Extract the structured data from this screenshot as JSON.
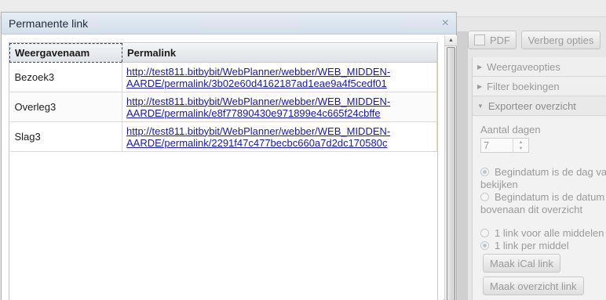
{
  "dialog": {
    "title": "Permanente link",
    "close_glyph": "×",
    "table": {
      "headers": [
        "Weergavenaam",
        "Permalink"
      ],
      "rows": [
        {
          "name": "Bezoek3",
          "link_line1": "http://test811.bitbybit/WebPlanner/webber/WEB_MIDDEN-",
          "link_line2": "AARDE/permalink/3b02e60d4162187ad1eae9a4f5cedf01"
        },
        {
          "name": "Overleg3",
          "link_line1": "http://test811.bitbybit/WebPlanner/webber/WEB_MIDDEN-",
          "link_line2": "AARDE/permalink/e8f77890430e971899e4c665f24cbffe"
        },
        {
          "name": "Slag3",
          "link_line1": "http://test811.bitbybit/WebPlanner/webber/WEB_MIDDEN-",
          "link_line2": "AARDE/permalink/2291f47c477becbc660a7d2dc170580c"
        }
      ]
    }
  },
  "background": {
    "toolbar": {
      "pdf_label": "PDF",
      "hide_options_label": "Verberg opties"
    },
    "panel": {
      "sections": [
        "Weergaveopties",
        "Filter boekingen",
        "Exporteer overzicht"
      ],
      "days_label": "Aantal dagen",
      "days_value": "7",
      "radio_start_1_line1": "Begindatum is de dag va",
      "radio_start_1_line2": "bekijken",
      "radio_start_2_line1": "Begindatum is de datum",
      "radio_start_2_line2": "bovenaan dit overzicht",
      "radio_link_all": "1 link voor alle middelen",
      "radio_link_per": "1 link per middel",
      "ical_button": "Maak iCal link",
      "overview_button": "Maak overzicht link"
    }
  },
  "icons": {
    "close": "close-icon",
    "collapsed": "triangle-right-icon",
    "expanded": "triangle-down-icon",
    "scroll_up": "chevron-up-icon"
  }
}
